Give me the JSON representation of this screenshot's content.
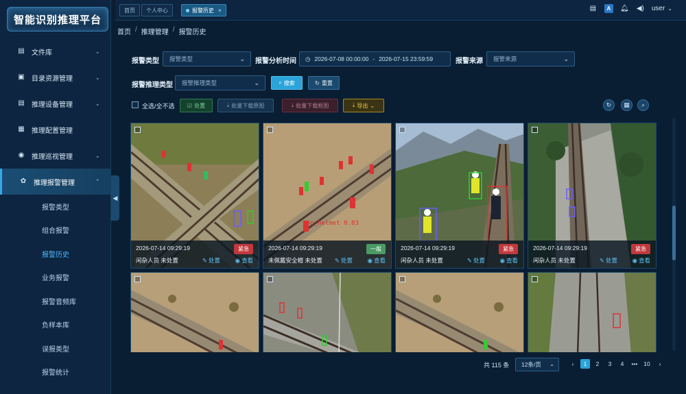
{
  "app": {
    "title": "智能识别推理平台"
  },
  "sidebar": {
    "items": [
      {
        "label": "文件库",
        "icon": "database-icon"
      },
      {
        "label": "目录资源管理",
        "icon": "folder-icon"
      },
      {
        "label": "推理设备管理",
        "icon": "server-icon"
      },
      {
        "label": "推理配置管理",
        "icon": "config-icon"
      },
      {
        "label": "推理巡视管理",
        "icon": "patrol-icon"
      },
      {
        "label": "推理报警管理",
        "icon": "alarm-icon"
      }
    ],
    "sub_items": [
      "报警类型",
      "组合报警",
      "报警历史",
      "业务报警",
      "报警音频库",
      "负样本库",
      "误报类型",
      "报警统计"
    ],
    "active_sub": "报警历史"
  },
  "tabs": [
    {
      "label": "首页"
    },
    {
      "label": "个人中心"
    },
    {
      "label": "报警历史",
      "close": "×"
    }
  ],
  "header": {
    "user": "user"
  },
  "breadcrumb": [
    "首页",
    "推理管理",
    "报警历史"
  ],
  "filters": {
    "type_label": "报警类型",
    "type_placeholder": "报警类型",
    "time_label": "报警分析时间",
    "time_start": "2026-07-08 00:00:00",
    "time_sep": "-",
    "time_end": "2026-07-15 23:59:59",
    "source_label": "报警来源",
    "source_placeholder": "报警来源",
    "infer_label": "报警推理类型",
    "infer_placeholder": "报警推理类型",
    "search": "搜索",
    "reset": "重置"
  },
  "toolbar": {
    "select_all": "全选/全不选",
    "deal": "处置",
    "batch_download": "批量下载原图",
    "batch_box_download": "批量下载框图",
    "export": "导出"
  },
  "cards": [
    {
      "time": "2026-07-14 09:29:19",
      "level": "紧急",
      "level_color": "#c2393d",
      "type": "闲杂人员",
      "status": "未处置",
      "deal": "处置",
      "view": "查看",
      "label_text": ""
    },
    {
      "time": "2026-07-14 09:29:19",
      "level": "一般",
      "level_color": "#4a9a63",
      "type": "未佩戴安全帽",
      "status": "未处置",
      "deal": "处置",
      "view": "查看",
      "label_text": "no_helmet 0.83"
    },
    {
      "time": "2026-07-14 09:29:19",
      "level": "紧急",
      "level_color": "#c2393d",
      "type": "闲杂人员",
      "status": "未处置",
      "deal": "处置",
      "view": "查看",
      "label_text": ""
    },
    {
      "time": "2026-07-14 09:29:19",
      "level": "紧急",
      "level_color": "#c2393d",
      "type": "闲杂人员",
      "status": "未处置",
      "deal": "处置",
      "view": "查看",
      "label_text": ""
    },
    {
      "label_text": ""
    },
    {
      "label_text": ""
    },
    {
      "label_text": ""
    },
    {
      "label_text": ""
    }
  ],
  "pagination": {
    "total": "共 115 条",
    "page_size": "12条/页",
    "prev": "‹",
    "pages": [
      "1",
      "2",
      "3",
      "4",
      "•••",
      "10"
    ],
    "next": "›",
    "active_page": "1"
  }
}
